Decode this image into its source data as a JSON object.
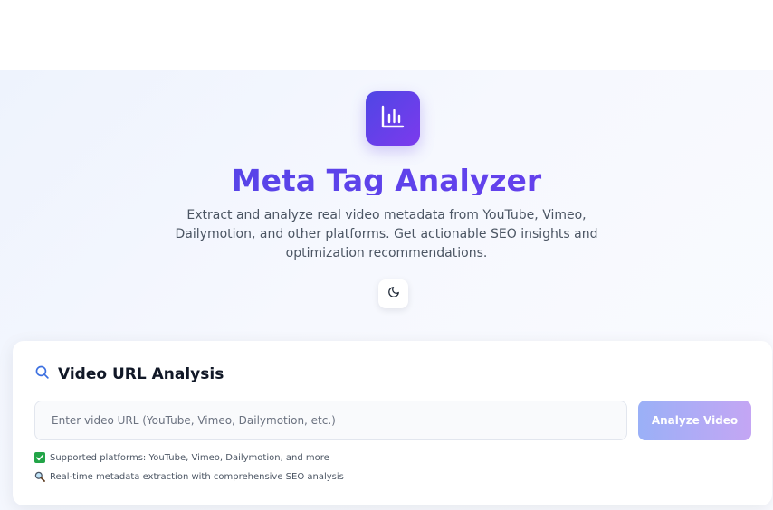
{
  "header": {
    "title": "Meta Tag Analyzer",
    "subtitle": "Extract and analyze real video metadata from YouTube, Vimeo, Dailymotion, and other platforms. Get actionable SEO insights and optimization recommendations.",
    "logo_icon": "bar-chart-icon",
    "theme_toggle_icon": "moon-icon"
  },
  "analysis": {
    "title": "Video URL Analysis",
    "title_icon": "search-icon",
    "input_placeholder": "Enter video URL (YouTube, Vimeo, Dailymotion, etc.)",
    "input_value": "",
    "button_label": "Analyze Video",
    "notes": [
      {
        "icon": "check-mark-icon",
        "text": "Supported platforms: YouTube, Vimeo, Dailymotion, and more"
      },
      {
        "icon": "magnifier-icon",
        "text": "Real-time metadata extraction with comprehensive SEO analysis"
      }
    ]
  },
  "colors": {
    "accent": "#4f46e5",
    "accent_purple": "#7c3aed",
    "button_gradient_start": "#9ab0f7",
    "button_gradient_end": "#c4a6f4",
    "check_green": "#22a447"
  }
}
